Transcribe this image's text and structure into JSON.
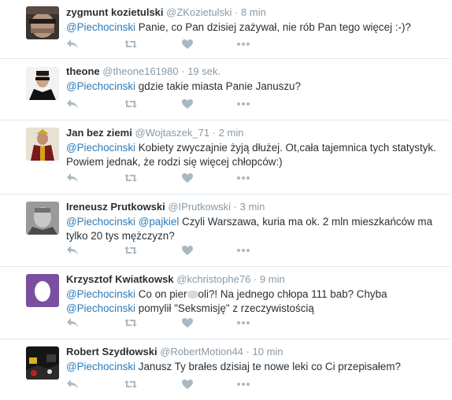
{
  "colors": {
    "mention": "#2b7bb9",
    "muted": "#8899a6",
    "text": "#292f33",
    "action_icon": "#aab8c2",
    "divider": "#e1e8ed"
  },
  "icons": {
    "reply": "reply-icon",
    "retweet": "retweet-icon",
    "like": "heart-icon",
    "more": "more-icon"
  },
  "tweets": [
    {
      "name": "zygmunt kozietulski",
      "handle": "@ZKozietulski",
      "sep": "·",
      "time": "8 min",
      "mention1": "@Piechocinski",
      "text1": " Panie, co Pan dzisiej zażywał, nie rób Pan tego więcej :-)?"
    },
    {
      "name": "theone",
      "handle": "@theone161980",
      "sep": "·",
      "time": "19 sek.",
      "mention1": "@Piechocinski",
      "text1": " gdzie takie miasta Panie Januszu?"
    },
    {
      "name": "Jan bez ziemi",
      "handle": "@Wojtaszek_71",
      "sep": "·",
      "time": "2 min",
      "mention1": "@Piechocinski",
      "text1": "  Kobiety zwyczajnie żyją dłużej. Ot,cała tajemnica tych statystyk. Powiem jednak, że rodzi się więcej chłopców:)"
    },
    {
      "name": "Ireneusz Prutkowski",
      "handle": "@IPrutkowski",
      "sep": "·",
      "time": "3 min",
      "mention1": "@Piechocinski",
      "mention2": "@pajkiel",
      "text1": " Czyli Warszawa, kuria ma ok. 2 mln mieszkańców ma tylko 20 tys mężczyzn?"
    },
    {
      "name": "Krzysztof Kwiatkowsk",
      "handle": "@kchristophe76",
      "sep": "·",
      "time": "9 min",
      "mention1": "@Piechocinski",
      "text1a": " Co on pier",
      "text1b": "oli?! Na jednego chłopa 111 bab? Chyba ",
      "mention2": "@Piechocinski",
      "text2": " pomylił \"Seksmisję\" z rzeczywistością"
    },
    {
      "name": "Robert Szydłowski",
      "handle": "@RobertMotion44",
      "sep": "·",
      "time": "10 min",
      "mention1": "@Piechocinski",
      "text1": " Janusz Ty brałes dzisiaj te nowe leki co Ci przepisałem?"
    }
  ]
}
